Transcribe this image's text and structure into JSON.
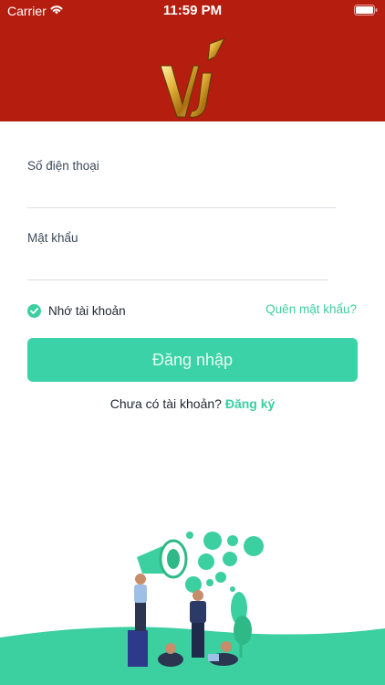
{
  "status_bar": {
    "carrier": "Carrier",
    "time": "11:59 PM"
  },
  "login_form": {
    "phone_label": "Số điện thoại",
    "phone_value": "",
    "password_label": "Mật khẩu",
    "password_value": "",
    "remember_label": "Nhớ tài khoản",
    "remember_checked": true,
    "forgot_password": "Quên mật khẩu?",
    "login_button": "Đăng nhập",
    "no_account_text": "Chưa có tài khoản?",
    "signup_link": "Đăng ký"
  },
  "colors": {
    "header": "#b51d0e",
    "accent": "#3ccf9f",
    "button": "#3ad2a6"
  }
}
